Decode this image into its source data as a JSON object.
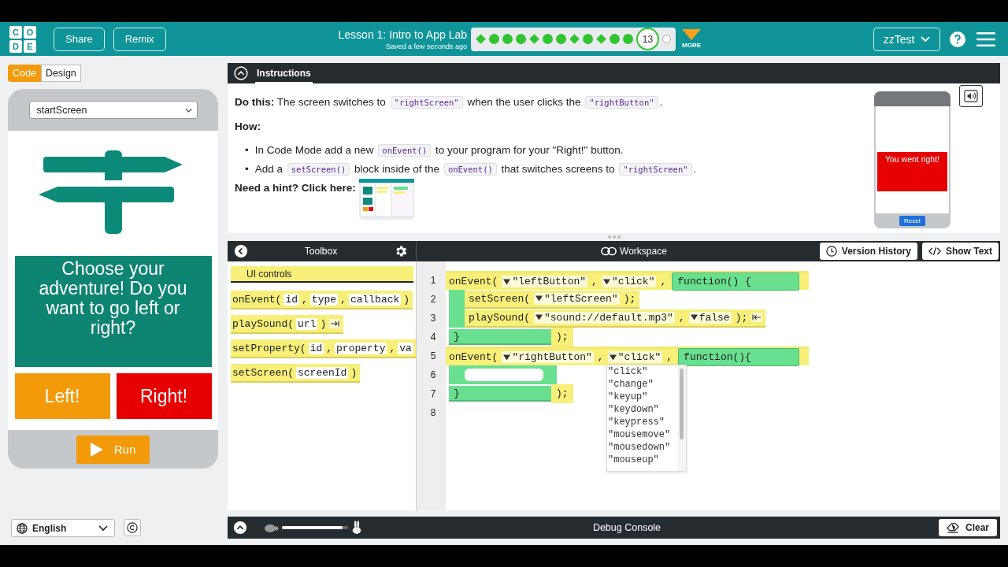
{
  "header": {
    "logo_letters": [
      "C",
      "O",
      "D",
      "E"
    ],
    "buttons": [
      "Share",
      "Remix"
    ],
    "title": "Lesson 1: Intro to App Lab",
    "saved": "Saved a few seconds ago",
    "progress": [
      {
        "kind": "diamond",
        "completed": true
      },
      {
        "kind": "dot",
        "completed": true
      },
      {
        "kind": "dot",
        "completed": true
      },
      {
        "kind": "dot",
        "completed": true
      },
      {
        "kind": "diamond",
        "completed": true
      },
      {
        "kind": "dot",
        "completed": true
      },
      {
        "kind": "dot",
        "completed": true
      },
      {
        "kind": "diamond",
        "completed": true
      },
      {
        "kind": "dot",
        "completed": true
      },
      {
        "kind": "diamond",
        "completed": true
      },
      {
        "kind": "dot",
        "completed": true
      },
      {
        "kind": "dot",
        "completed": true
      },
      {
        "kind": "current",
        "label": "13"
      },
      {
        "kind": "dot",
        "completed": false
      }
    ],
    "more": "MORE",
    "user": "zzTest"
  },
  "mode_toggle": [
    {
      "label": "Code",
      "selected": true
    },
    {
      "label": "Design",
      "selected": false
    }
  ],
  "app_preview": {
    "screen_select": "startScreen",
    "prompt": "Choose your adventure! Do you want to go left or right?",
    "buttons": [
      {
        "label": "Left!",
        "color": "#f29a0a"
      },
      {
        "label": "Right!",
        "color": "#e60000"
      }
    ],
    "run": "Run"
  },
  "language": "English",
  "instructions": {
    "title": "Instructions",
    "paragraphs": [
      [
        {
          "kind": "bold",
          "text": "Do this:"
        },
        {
          "kind": "text",
          "text": " The screen switches to "
        },
        {
          "kind": "code",
          "text": "\"rightScreen\""
        },
        {
          "kind": "text",
          "text": " when the user clicks the "
        },
        {
          "kind": "code",
          "text": "\"rightButton\""
        },
        {
          "kind": "text",
          "text": "."
        }
      ],
      [
        {
          "kind": "bold",
          "text": "How:"
        }
      ]
    ],
    "bullets": [
      {
        "marker": "•",
        "segments": [
          {
            "kind": "text",
            "text": "In Code Mode add a new "
          },
          {
            "kind": "code",
            "text": "onEvent()"
          },
          {
            "kind": "text",
            "text": " to your program for your \"Right!\" button."
          }
        ]
      },
      {
        "marker": "•",
        "segments": [
          {
            "kind": "text",
            "text": "Add a "
          },
          {
            "kind": "code",
            "text": "setScreen()"
          },
          {
            "kind": "text",
            "text": " block inside of the "
          },
          {
            "kind": "code",
            "text": "onEvent()"
          },
          {
            "kind": "text",
            "text": " that switches screens to "
          },
          {
            "kind": "code",
            "text": "\"rightScreen\""
          },
          {
            "kind": "text",
            "text": "."
          }
        ]
      }
    ],
    "hint": "Need a hint? Click here:",
    "result_preview": {
      "message": "You went right!",
      "reset": "Reset"
    }
  },
  "toolbox": {
    "title": "Toolbox",
    "category": "UI controls",
    "blocks": [
      {
        "tokens": [
          {
            "kind": "text",
            "text": "onEvent("
          },
          {
            "kind": "param",
            "text": "id"
          },
          {
            "kind": "text",
            "text": ","
          },
          {
            "kind": "param",
            "text": "type"
          },
          {
            "kind": "text",
            "text": ","
          },
          {
            "kind": "param",
            "text": "callback"
          },
          {
            "kind": "text",
            "text": ")"
          }
        ],
        "optional_toggle": false
      },
      {
        "tokens": [
          {
            "kind": "text",
            "text": "playSound("
          },
          {
            "kind": "param",
            "text": "url"
          },
          {
            "kind": "text",
            "text": ")"
          }
        ],
        "optional_toggle": true
      },
      {
        "tokens": [
          {
            "kind": "text",
            "text": "setProperty("
          },
          {
            "kind": "param",
            "text": "id"
          },
          {
            "kind": "text",
            "text": ","
          },
          {
            "kind": "param",
            "text": "property"
          },
          {
            "kind": "text",
            "text": ","
          },
          {
            "kind": "param",
            "text": "va"
          }
        ],
        "optional_toggle": false
      },
      {
        "tokens": [
          {
            "kind": "text",
            "text": "setScreen("
          },
          {
            "kind": "param",
            "text": "screenId"
          },
          {
            "kind": "text",
            "text": ")"
          }
        ],
        "optional_toggle": false
      }
    ]
  },
  "workspace": {
    "title": "Workspace",
    "buttons": [
      "Version History",
      "Show Text"
    ],
    "lines": [
      {
        "number": "1",
        "kind": "event_head",
        "tokens": [
          {
            "kind": "text",
            "text": "onEvent("
          },
          {
            "kind": "dropdown",
            "text": "\"leftButton\""
          },
          {
            "kind": "text",
            "text": ","
          },
          {
            "kind": "dropdown",
            "text": "\"click\""
          },
          {
            "kind": "text",
            "text": ","
          }
        ],
        "func": "function() {"
      },
      {
        "number": "2",
        "kind": "statement",
        "tokens": [
          {
            "kind": "text",
            "text": "setScreen("
          },
          {
            "kind": "dropdown",
            "text": "\"leftScreen\""
          },
          {
            "kind": "text",
            "text": ");"
          }
        ],
        "optional_toggle": false
      },
      {
        "number": "3",
        "kind": "statement",
        "tokens": [
          {
            "kind": "text",
            "text": "playSound("
          },
          {
            "kind": "dropdown",
            "text": "\"sound://default.mp3\""
          },
          {
            "kind": "text",
            "text": ","
          },
          {
            "kind": "dropdown",
            "text": "false"
          },
          {
            "kind": "text",
            "text": ");"
          }
        ],
        "optional_toggle": true
      },
      {
        "number": "4",
        "kind": "event_end",
        "brace": "}",
        "close": ");"
      },
      {
        "number": "5",
        "kind": "event_head",
        "tokens": [
          {
            "kind": "text",
            "text": "onEvent("
          },
          {
            "kind": "dropdown",
            "text": "\"rightButton\""
          },
          {
            "kind": "text",
            "text": ","
          },
          {
            "kind": "dropdown",
            "text": "\"click\""
          },
          {
            "kind": "text",
            "text": ","
          }
        ],
        "func": "function(){"
      },
      {
        "number": "6",
        "kind": "empty_body"
      },
      {
        "number": "7",
        "kind": "event_end",
        "brace": "}",
        "close": ");"
      },
      {
        "number": "8",
        "kind": "blank"
      }
    ],
    "dropdown_options": [
      "\"click\"",
      "\"change\"",
      "\"keyup\"",
      "\"keydown\"",
      "\"keypress\"",
      "\"mousemove\"",
      "\"mousedown\"",
      "\"mouseup\""
    ]
  },
  "debug": {
    "title": "Debug Console",
    "speed": {
      "level": 0.92
    },
    "clear": "Clear"
  }
}
